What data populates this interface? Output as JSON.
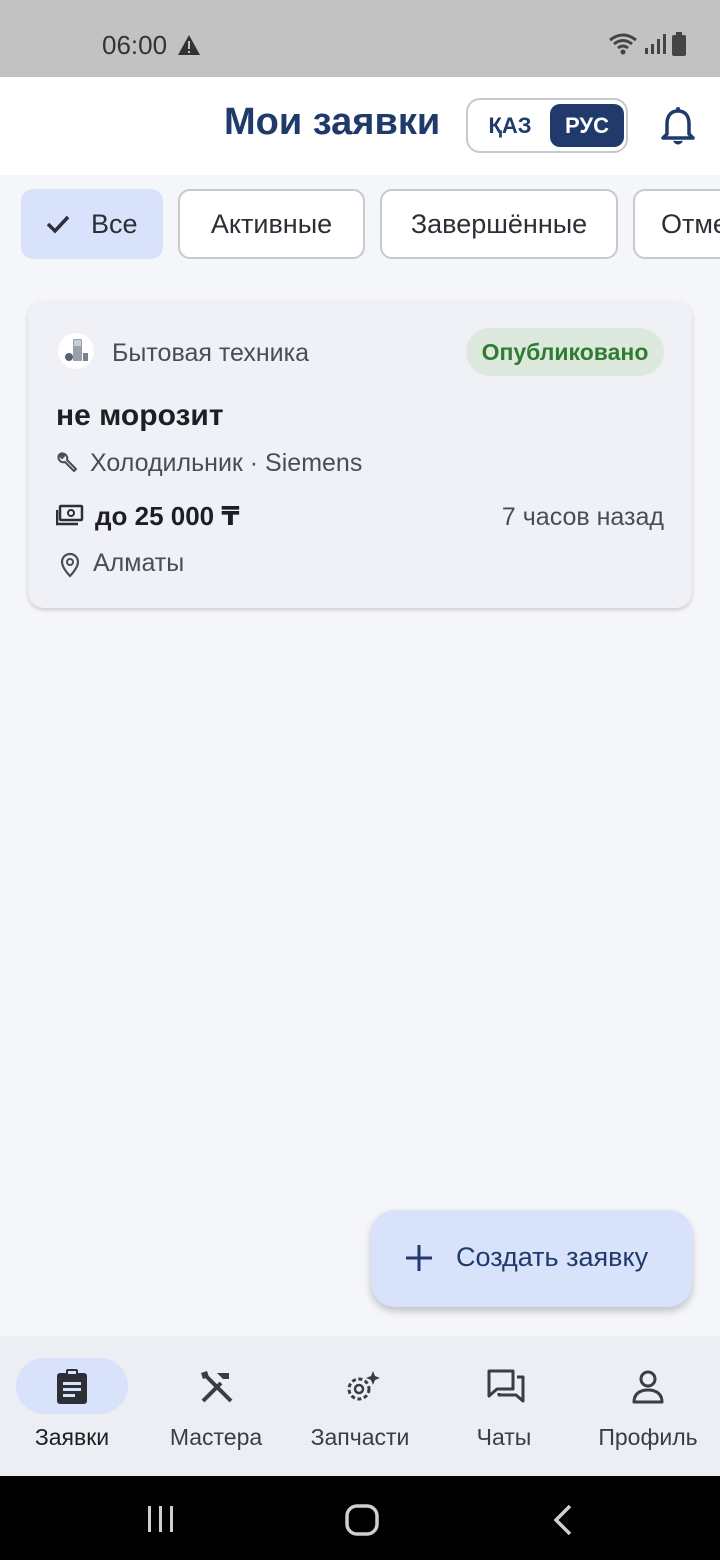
{
  "status_bar": {
    "time": "06:00"
  },
  "header": {
    "title": "Мои заявки",
    "lang_kaz": "ҚАЗ",
    "lang_rus": "РУС"
  },
  "filters": [
    {
      "label": "Все",
      "selected": true
    },
    {
      "label": "Активные",
      "selected": false
    },
    {
      "label": "Завершённые",
      "selected": false
    },
    {
      "label": "Отменённые",
      "selected": false
    }
  ],
  "request_card": {
    "category": "Бытовая техника",
    "status": "Опубликовано",
    "title": "не морозит",
    "device": "Холодильник · Siemens",
    "price": "до 25 000 ₸",
    "time_ago": "7 часов назад",
    "city": "Алматы"
  },
  "fab": {
    "label": "Создать заявку"
  },
  "bottom_nav": [
    {
      "label": "Заявки",
      "icon": "clipboard-icon",
      "active": true
    },
    {
      "label": "Мастера",
      "icon": "tools-icon",
      "active": false
    },
    {
      "label": "Запчасти",
      "icon": "gear-sparkle-icon",
      "active": false
    },
    {
      "label": "Чаты",
      "icon": "chat-icon",
      "active": false
    },
    {
      "label": "Профиль",
      "icon": "person-icon",
      "active": false
    }
  ],
  "colors": {
    "primary": "#1f3a6b",
    "chip_selected": "#d9e2fb",
    "status_published_bg": "#dde9dc",
    "status_published_text": "#2e7d32"
  }
}
